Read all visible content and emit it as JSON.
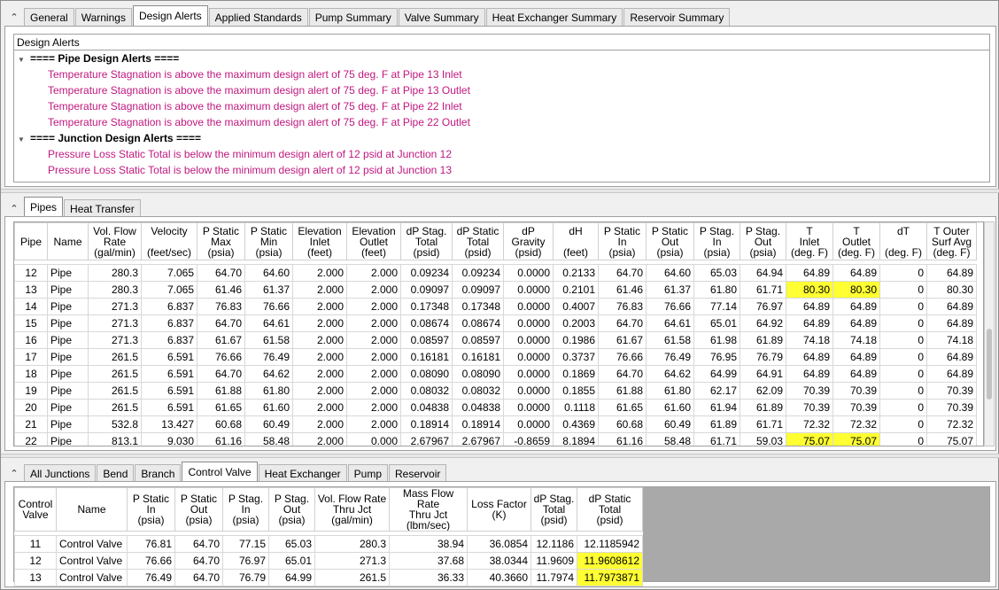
{
  "top_tabs": [
    "General",
    "Warnings",
    "Design Alerts",
    "Applied Standards",
    "Pump Summary",
    "Valve Summary",
    "Heat Exchanger Summary",
    "Reservoir Summary"
  ],
  "top_active": 2,
  "alerts": {
    "title": "Design Alerts",
    "groups": [
      {
        "label": "==== Pipe Design Alerts ====",
        "items": [
          "Temperature Stagnation is above the maximum design alert of 75 deg. F at Pipe 13 Inlet",
          "Temperature Stagnation is above the maximum design alert of 75 deg. F at Pipe 13 Outlet",
          "Temperature Stagnation is above the maximum design alert of 75 deg. F at Pipe 22 Inlet",
          "Temperature Stagnation is above the maximum design alert of 75 deg. F at Pipe 22 Outlet"
        ]
      },
      {
        "label": "==== Junction Design Alerts ====",
        "items": [
          "Pressure Loss Static Total is below the minimum design alert of 12 psid at Junction 12",
          "Pressure Loss Static Total is below the minimum design alert of 12 psid at Junction 13"
        ]
      }
    ]
  },
  "mid_tabs": [
    "Pipes",
    "Heat Transfer"
  ],
  "mid_active": 0,
  "pipes": {
    "headers": [
      "Pipe",
      "Name",
      "Vol. Flow\nRate\n(gal/min)",
      "Velocity\n\n(feet/sec)",
      "P Static\nMax\n(psia)",
      "P Static\nMin\n(psia)",
      "Elevation\nInlet\n(feet)",
      "Elevation\nOutlet\n(feet)",
      "dP Stag.\nTotal\n(psid)",
      "dP Static\nTotal\n(psid)",
      "dP\nGravity\n(psid)",
      "dH\n\n(feet)",
      "P Static\nIn\n(psia)",
      "P Static\nOut\n(psia)",
      "P Stag.\nIn\n(psia)",
      "P Stag.\nOut\n(psia)",
      "T\nInlet\n(deg. F)",
      "T\nOutlet\n(deg. F)",
      "dT\n\n(deg. F)",
      "T Outer\nSurf Avg\n(deg. F)"
    ],
    "rows": [
      [
        "12",
        "Pipe",
        "280.3",
        "7.065",
        "64.70",
        "64.60",
        "2.000",
        "2.000",
        "0.09234",
        "0.09234",
        "0.0000",
        "0.2133",
        "64.70",
        "64.60",
        "65.03",
        "64.94",
        "64.89",
        "64.89",
        "0",
        "64.89"
      ],
      [
        "13",
        "Pipe",
        "280.3",
        "7.065",
        "61.46",
        "61.37",
        "2.000",
        "2.000",
        "0.09097",
        "0.09097",
        "0.0000",
        "0.2101",
        "61.46",
        "61.37",
        "61.80",
        "61.71",
        "80.30",
        "80.30",
        "0",
        "80.30"
      ],
      [
        "14",
        "Pipe",
        "271.3",
        "6.837",
        "76.83",
        "76.66",
        "2.000",
        "2.000",
        "0.17348",
        "0.17348",
        "0.0000",
        "0.4007",
        "76.83",
        "76.66",
        "77.14",
        "76.97",
        "64.89",
        "64.89",
        "0",
        "64.89"
      ],
      [
        "15",
        "Pipe",
        "271.3",
        "6.837",
        "64.70",
        "64.61",
        "2.000",
        "2.000",
        "0.08674",
        "0.08674",
        "0.0000",
        "0.2003",
        "64.70",
        "64.61",
        "65.01",
        "64.92",
        "64.89",
        "64.89",
        "0",
        "64.89"
      ],
      [
        "16",
        "Pipe",
        "271.3",
        "6.837",
        "61.67",
        "61.58",
        "2.000",
        "2.000",
        "0.08597",
        "0.08597",
        "0.0000",
        "0.1986",
        "61.67",
        "61.58",
        "61.98",
        "61.89",
        "74.18",
        "74.18",
        "0",
        "74.18"
      ],
      [
        "17",
        "Pipe",
        "261.5",
        "6.591",
        "76.66",
        "76.49",
        "2.000",
        "2.000",
        "0.16181",
        "0.16181",
        "0.0000",
        "0.3737",
        "76.66",
        "76.49",
        "76.95",
        "76.79",
        "64.89",
        "64.89",
        "0",
        "64.89"
      ],
      [
        "18",
        "Pipe",
        "261.5",
        "6.591",
        "64.70",
        "64.62",
        "2.000",
        "2.000",
        "0.08090",
        "0.08090",
        "0.0000",
        "0.1869",
        "64.70",
        "64.62",
        "64.99",
        "64.91",
        "64.89",
        "64.89",
        "0",
        "64.89"
      ],
      [
        "19",
        "Pipe",
        "261.5",
        "6.591",
        "61.88",
        "61.80",
        "2.000",
        "2.000",
        "0.08032",
        "0.08032",
        "0.0000",
        "0.1855",
        "61.88",
        "61.80",
        "62.17",
        "62.09",
        "70.39",
        "70.39",
        "0",
        "70.39"
      ],
      [
        "20",
        "Pipe",
        "261.5",
        "6.591",
        "61.65",
        "61.60",
        "2.000",
        "2.000",
        "0.04838",
        "0.04838",
        "0.0000",
        "0.1118",
        "61.65",
        "61.60",
        "61.94",
        "61.89",
        "70.39",
        "70.39",
        "0",
        "70.39"
      ],
      [
        "21",
        "Pipe",
        "532.8",
        "13.427",
        "60.68",
        "60.49",
        "2.000",
        "2.000",
        "0.18914",
        "0.18914",
        "0.0000",
        "0.4369",
        "60.68",
        "60.49",
        "61.89",
        "61.71",
        "72.32",
        "72.32",
        "0",
        "72.32"
      ],
      [
        "22",
        "Pipe",
        "813.1",
        "9.030",
        "61.16",
        "58.48",
        "2.000",
        "0.000",
        "2.67967",
        "2.67967",
        "-0.8659",
        "8.1894",
        "61.16",
        "58.48",
        "61.71",
        "59.03",
        "75.07",
        "75.07",
        "0",
        "75.07"
      ]
    ],
    "highlight": [
      [
        1,
        16
      ],
      [
        1,
        17
      ],
      [
        10,
        16
      ],
      [
        10,
        17
      ]
    ]
  },
  "bottom_tabs": [
    "All Junctions",
    "Bend",
    "Branch",
    "Control Valve",
    "Heat Exchanger",
    "Pump",
    "Reservoir"
  ],
  "bottom_active": 3,
  "valves": {
    "headers": [
      "Control\nValve",
      "Name",
      "P Static\nIn\n(psia)",
      "P Static\nOut\n(psia)",
      "P Stag.\nIn\n(psia)",
      "P Stag.\nOut\n(psia)",
      "Vol. Flow Rate\nThru Jct\n(gal/min)",
      "Mass Flow Rate\nThru Jct\n(lbm/sec)",
      "Loss Factor\n(K)",
      "dP Stag.\nTotal\n(psid)",
      "dP Static\nTotal\n(psid)"
    ],
    "rows": [
      [
        "11",
        "Control Valve",
        "76.81",
        "64.70",
        "77.15",
        "65.03",
        "280.3",
        "38.94",
        "36.0854",
        "12.1186",
        "12.1185942"
      ],
      [
        "12",
        "Control Valve",
        "76.66",
        "64.70",
        "76.97",
        "65.01",
        "271.3",
        "37.68",
        "38.0344",
        "11.9609",
        "11.9608612"
      ],
      [
        "13",
        "Control Valve",
        "76.49",
        "64.70",
        "76.79",
        "64.99",
        "261.5",
        "36.33",
        "40.3660",
        "11.7974",
        "11.7973871"
      ]
    ],
    "highlight": [
      [
        1,
        10
      ],
      [
        2,
        10
      ]
    ]
  }
}
